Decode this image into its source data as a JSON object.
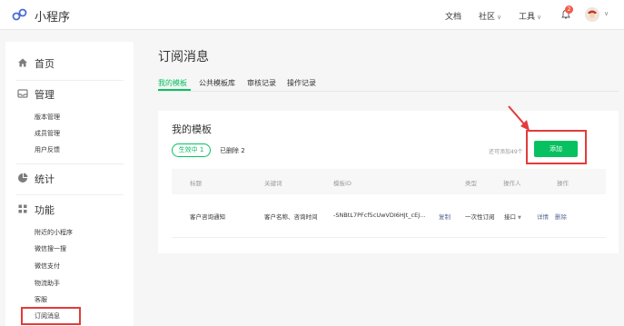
{
  "topbar": {
    "brand": "小程序",
    "nav": [
      "文档",
      "社区",
      "工具"
    ],
    "notification_count": "2"
  },
  "sidebar": {
    "home": "首页",
    "manage": "管理",
    "manage_items": [
      "版本管理",
      "成员管理",
      "用户反馈"
    ],
    "stats": "统计",
    "features": "功能",
    "feature_items": [
      "附近的小程序",
      "微信搜一搜",
      "微信支付",
      "物流助手",
      "客服",
      "订阅消息"
    ]
  },
  "main": {
    "title": "订阅消息",
    "tabs": [
      "我的模板",
      "公共模板库",
      "审核记录",
      "操作记录"
    ],
    "card": {
      "title": "我的模板",
      "active_pill": "生效中 1",
      "deleted": "已删除 2",
      "remaining": "还可添加49个",
      "add_button": "添加",
      "columns": [
        "标题",
        "关键词",
        "模板ID",
        "类型",
        "操作人",
        "操作"
      ],
      "row": {
        "title": "客户咨询通知",
        "keywords": "客户名称、咨询时间",
        "template_id": "-SNBtL7PFcf5cUwVDI6HJt_cEJ...",
        "copy": "复制",
        "type": "一次性订阅",
        "operator": "接口",
        "detail": "详情",
        "delete": "删除"
      }
    }
  },
  "colors": {
    "accent": "#07c160",
    "highlight": "#e33b3b",
    "link": "#576b95"
  }
}
